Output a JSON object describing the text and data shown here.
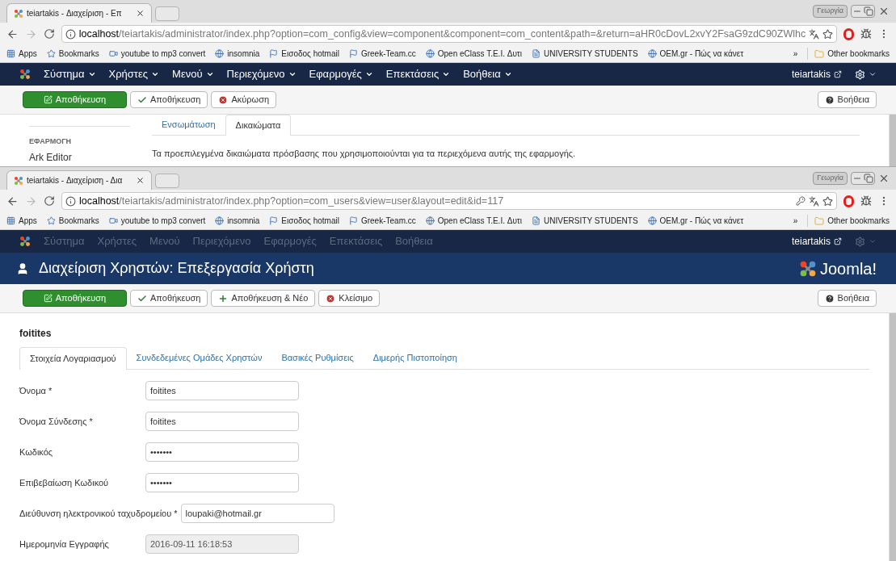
{
  "windows": [
    {
      "tab_title": "teiartakis - Διαχείριση - Επ",
      "profile": "Γεωργία",
      "url_host": "localhost",
      "url_path": "/teiartakis/administrator/index.php?option=com_config&view=component&component=com_content&path=&return=aHR0cDovL2xvY2FsaG9zdC90ZWlhc",
      "show_key_icon": false,
      "bookmarks": [
        "Apps",
        "Bookmarks",
        "youtube to mp3 convert",
        "insomnia",
        "Εισοδος hotmail",
        "Greek-Team.cc",
        "Open eClass T.E.I. Δυτι",
        "UNIVERSITY STUDENTS",
        "OEM.gr - Πώς να κάνετ"
      ],
      "bookmarks_more": "»",
      "other_bookmarks": "Other bookmarks",
      "menu": {
        "disabled": false,
        "items": [
          "Σύστημα",
          "Χρήστες",
          "Μενού",
          "Περιεχόμενο",
          "Εφαρμογές",
          "Επεκτάσεις",
          "Βοήθεια"
        ],
        "user": "teiartakis"
      },
      "toolbar": {
        "buttons": [
          {
            "kind": "primary",
            "label": "Αποθήκευση"
          },
          {
            "kind": "check",
            "label": "Αποθήκευση"
          },
          {
            "kind": "cancel",
            "label": "Ακύρωση"
          }
        ],
        "help": "Βοήθεια"
      },
      "config": {
        "sidebar": {
          "heading": "ΕΦΑΡΜΟΓΗ",
          "items": [
            "Ark Editor"
          ]
        },
        "tabs": [
          {
            "label": "Ενσωμάτωση",
            "selected": false
          },
          {
            "label": "Δικαιώματα",
            "selected": true
          }
        ],
        "description": "Τα προεπιλεγμένα δικαιώματα πρόσβασης που χρησιμοποιούνται για τα περιεχόμενα αυτής της εφαρμογής."
      }
    },
    {
      "tab_title": "teiartakis - Διαχείριση - Δια",
      "profile": "Γεωργία",
      "url_host": "localhost",
      "url_path": "/teiartakis/administrator/index.php?option=com_users&view=user&layout=edit&id=117",
      "show_key_icon": true,
      "bookmarks": [
        "Apps",
        "Bookmarks",
        "youtube to mp3 convert",
        "insomnia",
        "Εισοδος hotmail",
        "Greek-Team.cc",
        "Open eClass T.E.I. Δυτι",
        "UNIVERSITY STUDENTS",
        "OEM.gr - Πώς να κάνετ"
      ],
      "bookmarks_more": "»",
      "other_bookmarks": "Other bookmarks",
      "menu": {
        "disabled": true,
        "items": [
          "Σύστημα",
          "Χρήστες",
          "Μενού",
          "Περιεχόμενο",
          "Εφαρμογές",
          "Επεκτάσεις",
          "Βοήθεια"
        ],
        "user": "teiartakis"
      },
      "header": {
        "title": "Διαχείριση Χρηστών: Επεξεργασία Χρήστη",
        "brand": "Joomla!"
      },
      "toolbar": {
        "buttons": [
          {
            "kind": "primary",
            "label": "Αποθήκευση"
          },
          {
            "kind": "check",
            "label": "Αποθήκευση"
          },
          {
            "kind": "plus",
            "label": "Αποθήκευση & Νέο"
          },
          {
            "kind": "cancel",
            "label": "Κλείσιμο"
          }
        ],
        "help": "Βοήθεια"
      },
      "user_form": {
        "heading": "foitites",
        "tabs": [
          {
            "label": "Στοιχεία Λογαριασμού",
            "selected": true
          },
          {
            "label": "Συνδεδεμένες Ομάδες Χρηστών",
            "selected": false
          },
          {
            "label": "Βασικές Ρυθμίσεις",
            "selected": false
          },
          {
            "label": "Διμερής Πιστοποίηση",
            "selected": false
          }
        ],
        "fields": [
          {
            "label": "Όνομα *",
            "value": "foitites",
            "disabled": false
          },
          {
            "label": "Όνομα Σύνδεσης *",
            "value": "foitites",
            "disabled": false
          },
          {
            "label": "Κωδικός",
            "value": "•••••••",
            "disabled": false
          },
          {
            "label": "Επιβεβαίωση Κωδικού",
            "value": "•••••••",
            "disabled": false
          },
          {
            "label": "Διεύθυνση ηλεκτρονικού ταχυδρομείου *",
            "value": "loupaki@hotmail.gr",
            "disabled": false
          },
          {
            "label": "Ημερομηνία Εγγραφής",
            "value": "2016-09-11 16:18:53",
            "disabled": true
          }
        ]
      }
    }
  ]
}
